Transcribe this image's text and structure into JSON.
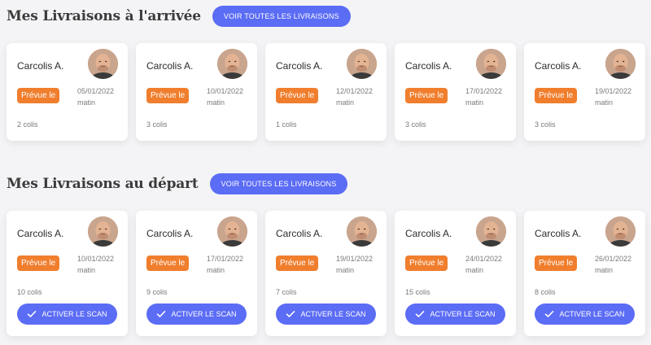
{
  "arrivals": {
    "title": "Mes Livraisons à l'arrivée",
    "view_all_label": "VOIR TOUTES LES LIVRAISONS",
    "cards": [
      {
        "name": "Carcolis A.",
        "badge": "Prévue le",
        "date": "05/01/2022",
        "period": "matin",
        "colis": "2 colis"
      },
      {
        "name": "Carcolis A.",
        "badge": "Prévue le",
        "date": "10/01/2022",
        "period": "matin",
        "colis": "3 colis"
      },
      {
        "name": "Carcolis A.",
        "badge": "Prévue le",
        "date": "12/01/2022",
        "period": "matin",
        "colis": "1 colis"
      },
      {
        "name": "Carcolis A.",
        "badge": "Prévue le",
        "date": "17/01/2022",
        "period": "matin",
        "colis": "3 colis"
      },
      {
        "name": "Carcolis A.",
        "badge": "Prévue le",
        "date": "19/01/2022",
        "period": "matin",
        "colis": "3 colis"
      }
    ]
  },
  "departures": {
    "title": "Mes Livraisons au départ",
    "view_all_label": "VOIR TOUTES LES LIVRAISONS",
    "scan_label": "ACTIVER LE SCAN",
    "cards": [
      {
        "name": "Carcolis A.",
        "badge": "Prévue le",
        "date": "10/01/2022",
        "period": "matin",
        "colis": "10 colis"
      },
      {
        "name": "Carcolis A.",
        "badge": "Prévue le",
        "date": "17/01/2022",
        "period": "matin",
        "colis": "9 colis"
      },
      {
        "name": "Carcolis A.",
        "badge": "Prévue le",
        "date": "19/01/2022",
        "period": "matin",
        "colis": "7 colis"
      },
      {
        "name": "Carcolis A.",
        "badge": "Prévue le",
        "date": "24/01/2022",
        "period": "matin",
        "colis": "15 colis"
      },
      {
        "name": "Carcolis A.",
        "badge": "Prévue le",
        "date": "26/01/2022",
        "period": "matin",
        "colis": "8 colis"
      }
    ]
  },
  "colors": {
    "accent": "#5b6cf5",
    "badge": "#f07e2d",
    "background": "#f4f4f6"
  },
  "icons": {
    "avatar": "person-photo",
    "scan": "check-icon"
  }
}
